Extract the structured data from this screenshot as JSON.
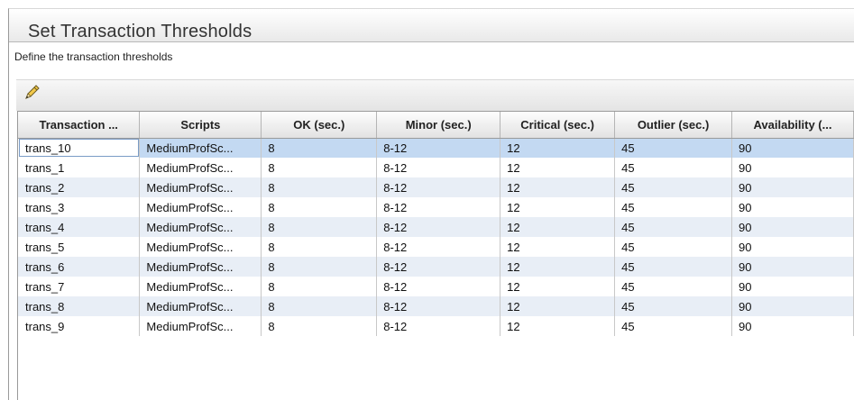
{
  "page": {
    "title": "Set Transaction Thresholds",
    "subtitle": "Define the transaction thresholds"
  },
  "toolbar": {
    "edit_icon": "pencil-icon"
  },
  "table": {
    "columns": [
      "Transaction ...",
      "Scripts",
      "OK (sec.)",
      "Minor (sec.)",
      "Critical (sec.)",
      "Outlier (sec.)",
      "Availability (..."
    ],
    "rows": [
      {
        "transaction": "trans_10",
        "script": "MediumProfSc...",
        "ok": "8",
        "minor": "8-12",
        "critical": "12",
        "outlier": "45",
        "availability": "90"
      },
      {
        "transaction": "trans_1",
        "script": "MediumProfSc...",
        "ok": "8",
        "minor": "8-12",
        "critical": "12",
        "outlier": "45",
        "availability": "90"
      },
      {
        "transaction": "trans_2",
        "script": "MediumProfSc...",
        "ok": "8",
        "minor": "8-12",
        "critical": "12",
        "outlier": "45",
        "availability": "90"
      },
      {
        "transaction": "trans_3",
        "script": "MediumProfSc...",
        "ok": "8",
        "minor": "8-12",
        "critical": "12",
        "outlier": "45",
        "availability": "90"
      },
      {
        "transaction": "trans_4",
        "script": "MediumProfSc...",
        "ok": "8",
        "minor": "8-12",
        "critical": "12",
        "outlier": "45",
        "availability": "90"
      },
      {
        "transaction": "trans_5",
        "script": "MediumProfSc...",
        "ok": "8",
        "minor": "8-12",
        "critical": "12",
        "outlier": "45",
        "availability": "90"
      },
      {
        "transaction": "trans_6",
        "script": "MediumProfSc...",
        "ok": "8",
        "minor": "8-12",
        "critical": "12",
        "outlier": "45",
        "availability": "90"
      },
      {
        "transaction": "trans_7",
        "script": "MediumProfSc...",
        "ok": "8",
        "minor": "8-12",
        "critical": "12",
        "outlier": "45",
        "availability": "90"
      },
      {
        "transaction": "trans_8",
        "script": "MediumProfSc...",
        "ok": "8",
        "minor": "8-12",
        "critical": "12",
        "outlier": "45",
        "availability": "90"
      },
      {
        "transaction": "trans_9",
        "script": "MediumProfSc...",
        "ok": "8",
        "minor": "8-12",
        "critical": "12",
        "outlier": "45",
        "availability": "90"
      }
    ]
  },
  "colors": {
    "selected_row": "#c3d9f2",
    "alt_row": "#e8eef6",
    "header_bg": "#e2e2e2"
  }
}
